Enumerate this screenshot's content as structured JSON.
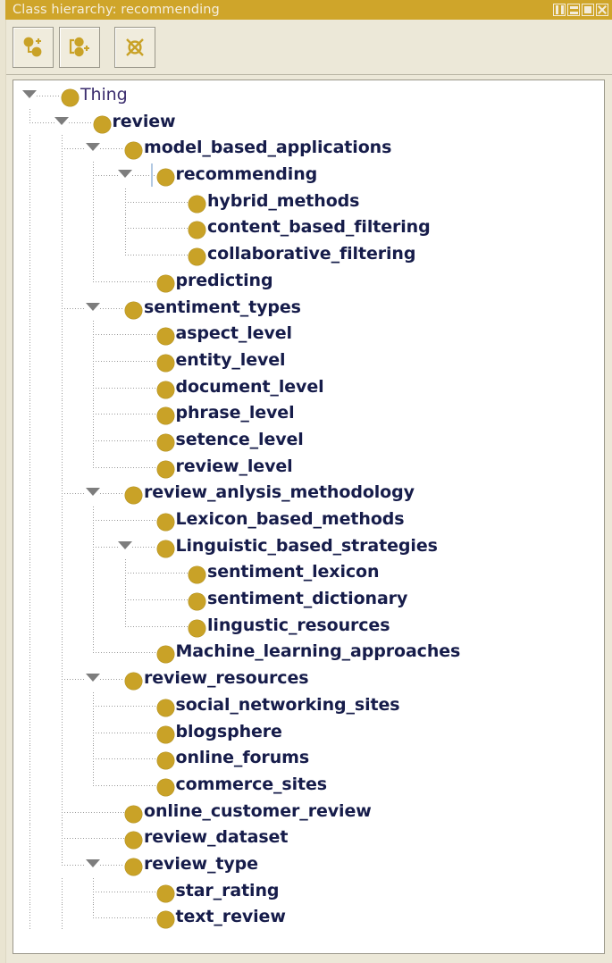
{
  "window": {
    "title": "Class hierarchy: recommending",
    "controls": [
      {
        "name": "split-view-button",
        "label": "Split view"
      },
      {
        "name": "minimize-button",
        "label": "Minimize"
      },
      {
        "name": "maximize-button",
        "label": "Maximize"
      },
      {
        "name": "close-button",
        "label": "Close"
      }
    ]
  },
  "toolbar": {
    "buttons": [
      {
        "name": "add-subclass-button",
        "icon": "add-subclass-icon",
        "tooltip": "Add subclass"
      },
      {
        "name": "add-sibling-class-button",
        "icon": "add-sibling-class-icon",
        "tooltip": "Add sibling class"
      },
      {
        "name": "delete-class-button",
        "icon": "delete-class-icon",
        "tooltip": "Delete class"
      }
    ]
  },
  "colors": {
    "titlebar": "#cfa52a",
    "titlebar_text": "#f5eedd",
    "node_circle": "#c9a227",
    "node_text": "#161c4a",
    "root_text": "#3b2d6e",
    "selection": "#c4d8ef",
    "panel_background": "#ece8d8",
    "tree_background": "#ffffff"
  },
  "tree": {
    "selected": "recommending",
    "nodes": [
      {
        "label": "Thing",
        "level": 0,
        "expanded": true,
        "root": true
      },
      {
        "label": "review",
        "level": 1,
        "expanded": true
      },
      {
        "label": "model_based_applications",
        "level": 2,
        "expanded": true
      },
      {
        "label": "recommending",
        "level": 3,
        "expanded": true,
        "selected": true
      },
      {
        "label": "hybrid_methods",
        "level": 4
      },
      {
        "label": "content_based_filtering",
        "level": 4
      },
      {
        "label": "collaborative_filtering",
        "level": 4
      },
      {
        "label": "predicting",
        "level": 3
      },
      {
        "label": "sentiment_types",
        "level": 2,
        "expanded": true
      },
      {
        "label": "aspect_level",
        "level": 3
      },
      {
        "label": "entity_level",
        "level": 3
      },
      {
        "label": "document_level",
        "level": 3
      },
      {
        "label": "phrase_level",
        "level": 3
      },
      {
        "label": "setence_level",
        "level": 3
      },
      {
        "label": "review_level",
        "level": 3
      },
      {
        "label": "review_anlysis_methodology",
        "level": 2,
        "expanded": true
      },
      {
        "label": "Lexicon_based_methods",
        "level": 3
      },
      {
        "label": "Linguistic_based_strategies",
        "level": 3,
        "expanded": true
      },
      {
        "label": "sentiment_lexicon",
        "level": 4
      },
      {
        "label": "sentiment_dictionary",
        "level": 4
      },
      {
        "label": "lingustic_resources",
        "level": 4
      },
      {
        "label": "Machine_learning_approaches",
        "level": 3
      },
      {
        "label": "review_resources",
        "level": 2,
        "expanded": true
      },
      {
        "label": "social_networking_sites",
        "level": 3
      },
      {
        "label": "blogsphere",
        "level": 3
      },
      {
        "label": "online_forums",
        "level": 3
      },
      {
        "label": "commerce_sites",
        "level": 3
      },
      {
        "label": "online_customer_review",
        "level": 2
      },
      {
        "label": "review_dataset",
        "level": 2
      },
      {
        "label": "review_type",
        "level": 2,
        "expanded": true
      },
      {
        "label": "star_rating",
        "level": 3
      },
      {
        "label": "text_review",
        "level": 3
      }
    ]
  }
}
